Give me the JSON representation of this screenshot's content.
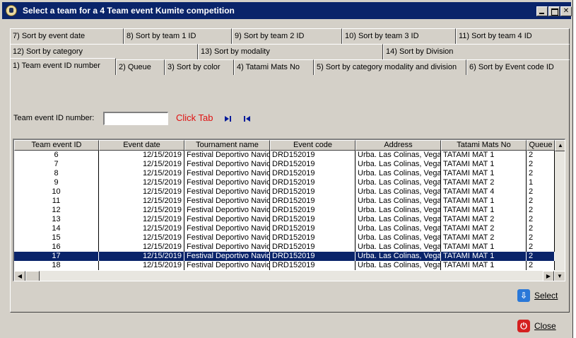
{
  "window": {
    "title": "Select a team for a 4 Team event Kumite competition"
  },
  "tabs": {
    "row1": [
      "7) Sort by event date",
      "8) Sort by team 1 ID",
      "9) Sort by team 2 ID",
      "10) Sort by team 3 ID",
      "11) Sort by team 4 ID"
    ],
    "row2": [
      "12) Sort by category",
      "13) Sort by modality",
      "14) Sort by Division"
    ],
    "row3": [
      "1) Team event ID number",
      "2) Queue",
      "3) Sort by color",
      "4) Tatami Mats No",
      "5) Sort by category modality and division",
      "6) Sort by Event code ID"
    ],
    "active": "1) Team event ID number"
  },
  "search": {
    "label": "Team event ID number:",
    "value": "",
    "click_tab_label": "Click Tab"
  },
  "icons": {
    "app": "karate-logo-icon",
    "go_last": "go-last-icon",
    "go_first": "go-first-icon",
    "select": "download-arrow-icon",
    "close": "power-icon"
  },
  "table": {
    "columns": [
      "Team event ID",
      "Event date",
      "Tournament name",
      "Event code",
      "Address",
      "Tatami Mats No",
      "Queue"
    ],
    "rows": [
      [
        "6",
        "12/15/2019",
        "Festival Deportivo Navid",
        "DRD152019",
        "Urba. Las Colinas, Vega",
        "TATAMI MAT 1",
        "2"
      ],
      [
        "7",
        "12/15/2019",
        "Festival Deportivo Navid",
        "DRD152019",
        "Urba. Las Colinas, Vega",
        "TATAMI MAT 1",
        "2"
      ],
      [
        "8",
        "12/15/2019",
        "Festival Deportivo Navid",
        "DRD152019",
        "Urba. Las Colinas, Vega",
        "TATAMI MAT 1",
        "2"
      ],
      [
        "9",
        "12/15/2019",
        "Festival Deportivo Navid",
        "DRD152019",
        "Urba. Las Colinas, Vega",
        "TATAMI MAT 2",
        "1"
      ],
      [
        "10",
        "12/15/2019",
        "Festival Deportivo Navid",
        "DRD152019",
        "Urba. Las Colinas, Vega",
        "TATAMI MAT 4",
        "2"
      ],
      [
        "11",
        "12/15/2019",
        "Festival Deportivo Navid",
        "DRD152019",
        "Urba. Las Colinas, Vega",
        "TATAMI MAT 1",
        "2"
      ],
      [
        "12",
        "12/15/2019",
        "Festival Deportivo Navid",
        "DRD152019",
        "Urba. Las Colinas, Vega",
        "TATAMI MAT 1",
        "2"
      ],
      [
        "13",
        "12/15/2019",
        "Festival Deportivo Navid",
        "DRD152019",
        "Urba. Las Colinas, Vega",
        "TATAMI MAT 2",
        "2"
      ],
      [
        "14",
        "12/15/2019",
        "Festival Deportivo Navid",
        "DRD152019",
        "Urba. Las Colinas, Vega",
        "TATAMI MAT 2",
        "2"
      ],
      [
        "15",
        "12/15/2019",
        "Festival Deportivo Navid",
        "DRD152019",
        "Urba. Las Colinas, Vega",
        "TATAMI MAT 2",
        "2"
      ],
      [
        "16",
        "12/15/2019",
        "Festival Deportivo Navid",
        "DRD152019",
        "Urba. Las Colinas, Vega",
        "TATAMI MAT 1",
        "2"
      ],
      [
        "17",
        "12/15/2019",
        "Festival Deportivo Navid",
        "DRD152019",
        "Urba. Las Colinas, Vega",
        "TATAMI MAT 1",
        "2"
      ],
      [
        "18",
        "12/15/2019",
        "Festival Deportivo Navid",
        "DRD152019",
        "Urba. Las Colinas, Vega",
        "TATAMI MAT 1",
        "2"
      ]
    ],
    "selected_row_id": "17"
  },
  "buttons": {
    "select": "Select",
    "close": "Close"
  },
  "colors": {
    "titlebar": "#0a246a",
    "selection": "#0a246a",
    "click_tab": "#e01010"
  }
}
